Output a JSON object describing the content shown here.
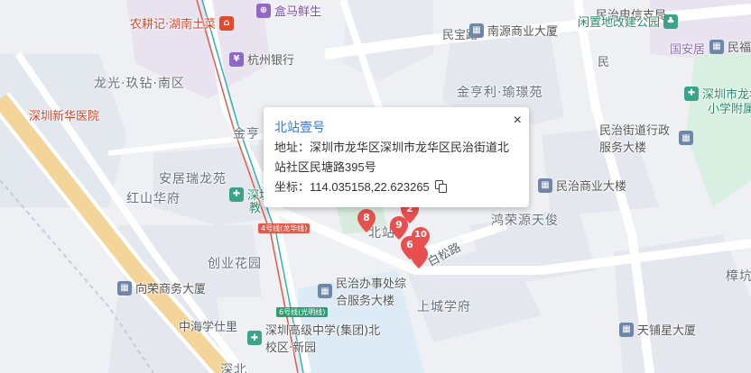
{
  "map": {
    "area_labels": [
      "龙光·玖钻·南区",
      "深圳新华医院",
      "金亨",
      "安居瑞龙苑",
      "红山华府",
      "创业花园",
      "上城学府",
      "中海学仕里",
      "金亨利·瑜璟苑",
      "鸿荣源天俊",
      "北站",
      "深北",
      "樟坑"
    ],
    "roads": [
      "民宝路",
      "白松路",
      "民"
    ],
    "pois": [
      {
        "name": "农耕记·湖南土菜",
        "icon": "restaurant-icon"
      },
      {
        "name": "盒马鲜生",
        "icon": "shopping-icon"
      },
      {
        "name": "杭州银行",
        "icon": "bank-icon"
      },
      {
        "name": "南源商业大厦",
        "icon": "building-icon"
      },
      {
        "name": "民治电信支局",
        "icon": "building-icon"
      },
      {
        "name": "闲置地改建公园",
        "icon": "park-icon"
      },
      {
        "name": "国安居",
        "icon": "store-icon"
      },
      {
        "name": "民福",
        "icon": "building-icon"
      },
      {
        "name": "深圳市龙华",
        "icon": "school-icon"
      },
      {
        "name": "小学附属",
        "icon": "school-icon"
      },
      {
        "name": "民治街道行政服务大楼",
        "icon": "building-icon"
      },
      {
        "name": "民治商业大楼",
        "icon": "building-icon"
      },
      {
        "name": "深圳",
        "icon": "school-icon"
      },
      {
        "name": "教",
        "icon": "school-icon"
      },
      {
        "name": "民治办事处综合服务大楼",
        "icon": "building-icon"
      },
      {
        "name": "向荣商务大厦",
        "icon": "building-icon"
      },
      {
        "name": "深圳高级中学(集团)北校区·新园",
        "icon": "school-icon"
      },
      {
        "name": "天铺星大厦",
        "icon": "building-icon"
      }
    ],
    "metro_badges": [
      "4号线(龙华线)",
      "6号线(光明线)"
    ],
    "markers": [
      "8",
      "2",
      "9",
      "10",
      "6"
    ],
    "colors": {
      "marker": "#e84f4f",
      "popup_title": "#3a76d8",
      "metro4": "#e25a4a",
      "metro6": "#2f9c74"
    }
  },
  "popup": {
    "title": "北站壹号",
    "close": "×",
    "address": "地址：深圳市龙华区深圳市龙华区民治街道北站社区民塘路395号",
    "coordinate": "坐标：114.035158,22.623265"
  }
}
